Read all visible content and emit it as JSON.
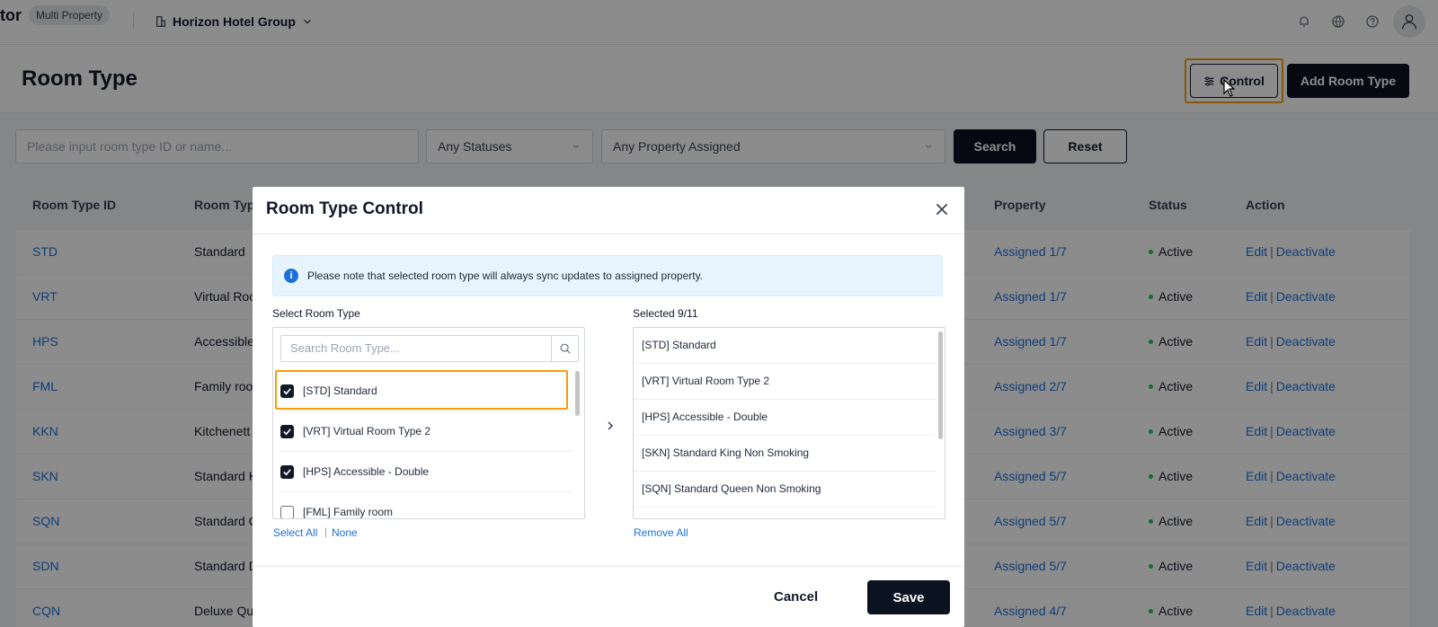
{
  "topbar": {
    "brand_fragment": "tor",
    "badge": "Multi Property",
    "group_name": "Horizon Hotel Group"
  },
  "header": {
    "title": "Room Type",
    "control_label": "Control",
    "add_label": "Add Room Type"
  },
  "filters": {
    "search_placeholder": "Please input room type ID or name...",
    "status_value": "Any Statuses",
    "property_value": "Any Property Assigned",
    "search_label": "Search",
    "reset_label": "Reset"
  },
  "table": {
    "headers": {
      "id": "Room Type ID",
      "name": "Room Typ",
      "property": "Property",
      "status": "Status",
      "action": "Action"
    },
    "rows": [
      {
        "id": "STD",
        "name": "Standard",
        "property": "Assigned 1/7",
        "status": "Active"
      },
      {
        "id": "VRT",
        "name": "Virtual Roo",
        "property": "Assigned 1/7",
        "status": "Active"
      },
      {
        "id": "HPS",
        "name": "Accessible",
        "property": "Assigned 1/7",
        "status": "Active"
      },
      {
        "id": "FML",
        "name": "Family roo",
        "property": "Assigned 2/7",
        "status": "Active"
      },
      {
        "id": "KKN",
        "name": "Kitchenett",
        "property": "Assigned 3/7",
        "status": "Active"
      },
      {
        "id": "SKN",
        "name": "Standard K",
        "property": "Assigned 5/7",
        "status": "Active"
      },
      {
        "id": "SQN",
        "name": "Standard Q",
        "property": "Assigned 5/7",
        "status": "Active"
      },
      {
        "id": "SDN",
        "name": "Standard D",
        "property": "Assigned 5/7",
        "status": "Active"
      },
      {
        "id": "CQN",
        "name": "Deluxe Qu",
        "property": "Assigned 4/7",
        "status": "Active"
      }
    ],
    "edit_label": "Edit",
    "deactivate_label": "Deactivate"
  },
  "modal": {
    "title": "Room Type Control",
    "notice": "Please note that selected room type will always sync updates to assigned property.",
    "select_label": "Select Room Type",
    "search_placeholder": "Search Room Type...",
    "options": [
      {
        "label": "[STD] Standard",
        "checked": true
      },
      {
        "label": "[VRT] Virtual Room Type 2",
        "checked": true
      },
      {
        "label": "[HPS] Accessible - Double",
        "checked": true
      },
      {
        "label": "[FML] Family room",
        "checked": false
      }
    ],
    "selected_label": "Selected 9/11",
    "selected": [
      "[STD] Standard",
      "[VRT] Virtual Room Type 2",
      "[HPS] Accessible - Double",
      "[SKN] Standard King Non Smoking",
      "[SQN] Standard Queen Non Smoking"
    ],
    "select_all": "Select All",
    "none": "None",
    "remove_all": "Remove All",
    "cancel": "Cancel",
    "save": "Save"
  },
  "colors": {
    "accent_link": "#1d6fd8",
    "primary_dark": "#0b1220",
    "highlight": "#f59e0b",
    "status_active": "#22c55e"
  }
}
